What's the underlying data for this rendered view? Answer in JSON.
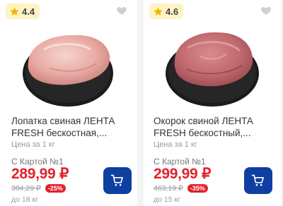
{
  "products": [
    {
      "rating": "4.4",
      "name": "Лопатка свиная ЛЕНТА FRESH бескостная,...",
      "unit_label": "Цена за 1 кг",
      "card_label": "С Картой №1",
      "price": "289,99 ₽",
      "old_price": "384,29 ₽",
      "discount": "-25%",
      "limit": "до 18 кг",
      "icons": {
        "rating": "star-icon",
        "favorite": "heart-icon",
        "cart": "cart-icon"
      }
    },
    {
      "rating": "4.6",
      "name": "Окорок свиной ЛЕНТА FRESH бескостный,...",
      "unit_label": "Цена за 1 кг",
      "card_label": "С Картой №1",
      "price": "299,99 ₽",
      "old_price": "463,19 ₽",
      "discount": "-35%",
      "limit": "до 15 кг",
      "icons": {
        "rating": "star-icon",
        "favorite": "heart-icon",
        "cart": "cart-icon"
      }
    }
  ],
  "colors": {
    "price": "#e3212c",
    "discount_badge": "#e3212c",
    "cart_button": "#0f3fa1",
    "rating_badge": "#fff3c4",
    "star": "#f5b400"
  }
}
